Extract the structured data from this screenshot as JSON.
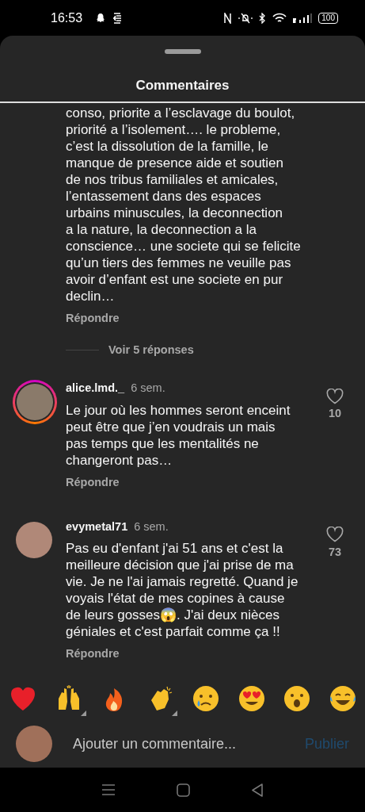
{
  "status_bar": {
    "time": "16:53",
    "battery": "100"
  },
  "sheet": {
    "title": "Commentaires"
  },
  "comments": [
    {
      "lines": [
        "conso, priorite a l’esclavage du boulot,",
        "priorité a l’isolement…. le probleme,",
        "c’est la dissolution de la famille, le",
        "manque de presence aide et soutien",
        "de nos tribus familiales et amicales,",
        "l’entassement dans des espaces",
        "urbains minuscules, la deconnection",
        "a la nature, la deconnection a la",
        "conscience… une societe qui se felicite",
        "qu’un tiers des femmes ne veuille pas",
        "avoir d’enfant est une societe en pur",
        "declin…"
      ],
      "reply": "Répondre",
      "view_replies": "Voir 5 réponses"
    },
    {
      "username": "alice.lmd._",
      "time": "6 sem.",
      "story_ring": true,
      "lines": [
        "Le jour où les hommes seront enceint",
        "peut être que j’en voudrais un mais",
        "pas temps que les mentalités ne",
        "changeront pas…"
      ],
      "reply": "Répondre",
      "likes": "10"
    },
    {
      "username": "evymetal71",
      "time": "6 sem.",
      "story_ring": false,
      "lines": [
        "Pas eu d'enfant j'ai 51 ans et c'est la",
        "meilleure décision que j'ai prise de ma",
        "vie. Je ne l'ai jamais regretté. Quand je",
        "voyais l'état de mes copines à cause",
        "de leurs gosses😱. J'ai  deux nièces",
        "géniales et c'est parfait comme ça !!"
      ],
      "reply": "Répondre",
      "likes": "73"
    }
  ],
  "reactions": [
    {
      "kind": "heart",
      "variants": false
    },
    {
      "kind": "raised-hands",
      "variants": true
    },
    {
      "kind": "fire",
      "variants": false
    },
    {
      "kind": "clap",
      "variants": true
    },
    {
      "kind": "cry",
      "variants": false
    },
    {
      "kind": "heart-eyes",
      "variants": false
    },
    {
      "kind": "wow",
      "variants": false
    },
    {
      "kind": "laugh",
      "variants": false
    }
  ],
  "composer": {
    "placeholder": "Ajouter un commentaire...",
    "submit": "Publier",
    "submit_disabled": true
  }
}
